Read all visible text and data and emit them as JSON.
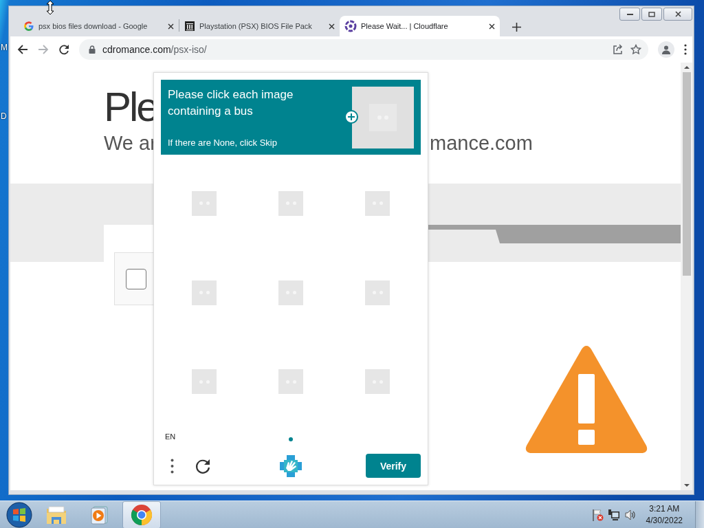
{
  "desktop": {
    "labels": [
      "M",
      "D"
    ]
  },
  "browser": {
    "tabs": [
      {
        "title": "psx bios files download - Google",
        "kind": "letter-g",
        "selected": false
      },
      {
        "title": "Playstation (PSX) BIOS File Pack",
        "kind": "building",
        "selected": false
      },
      {
        "title": "Please Wait... | Cloudflare",
        "kind": "ring",
        "selected": true
      }
    ],
    "address": {
      "host": "cdromance.com",
      "path": "/psx-iso/"
    }
  },
  "page": {
    "heading": "Ple",
    "subheading_left": "We ar",
    "subheading_right": "mance.com",
    "checkbox": {
      "checked": false
    }
  },
  "captcha": {
    "prompt": "Please click each image containing a bus",
    "hint": "If there are None, click Skip",
    "tiles": [
      {
        "selected": false
      },
      {
        "selected": false
      },
      {
        "selected": false
      },
      {
        "selected": false
      },
      {
        "selected": false
      },
      {
        "selected": false
      },
      {
        "selected": false
      },
      {
        "selected": false
      },
      {
        "selected": false
      }
    ],
    "language": "EN",
    "pages": [
      {
        "selected": true
      }
    ],
    "verify": "Verify"
  },
  "taskbar": {
    "apps": [
      {
        "kind": "folder",
        "active": false
      },
      {
        "kind": "media",
        "active": false
      },
      {
        "kind": "browser",
        "active": true
      }
    ],
    "clock": {
      "time": "3:21 AM",
      "date": "4/30/2022"
    }
  }
}
